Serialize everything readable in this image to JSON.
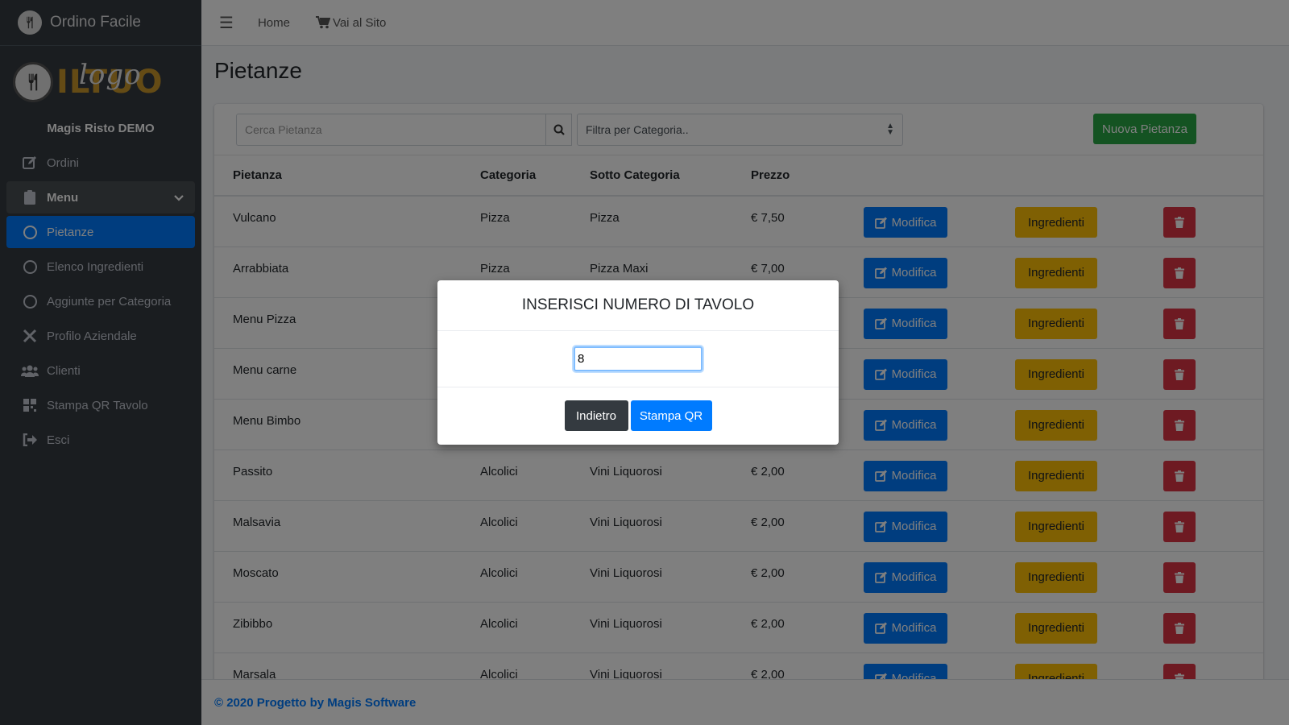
{
  "brand": {
    "title": "Ordino Facile",
    "icon": "fork-knife-icon"
  },
  "logo": {
    "text": "ILTUO",
    "script": "logo"
  },
  "company_name": "Magis Risto DEMO",
  "sidebar": {
    "items": [
      {
        "label": "Ordini",
        "icon": "edit-icon"
      },
      {
        "label": "Menu",
        "icon": "clipboard-icon"
      },
      {
        "label": "Pietanze",
        "icon": "circle-icon"
      },
      {
        "label": "Elenco Ingredienti",
        "icon": "circle-icon"
      },
      {
        "label": "Aggiunte per Categoria",
        "icon": "circle-icon"
      },
      {
        "label": "Profilo Aziendale",
        "icon": "tools-icon"
      },
      {
        "label": "Clienti",
        "icon": "users-icon"
      },
      {
        "label": "Stampa QR Tavolo",
        "icon": "qrcode-icon"
      },
      {
        "label": "Esci",
        "icon": "sign-out-icon"
      }
    ]
  },
  "topbar": {
    "home": "Home",
    "site": "Vai al Sito"
  },
  "page": {
    "title": "Pietanze"
  },
  "toolbar": {
    "search_placeholder": "Cerca Pietanza",
    "filter_label": "Filtra per Categoria..",
    "new_button": "Nuova Pietanza"
  },
  "table": {
    "headers": [
      "Pietanza",
      "Categoria",
      "Sotto Categoria",
      "Prezzo"
    ],
    "edit_label": "Modifica",
    "ingredients_label": "Ingredienti",
    "rows": [
      {
        "name": "Vulcano",
        "category": "Pizza",
        "subcategory": "Pizza",
        "price": "€ 7,50"
      },
      {
        "name": "Arrabbiata",
        "category": "Pizza",
        "subcategory": "Pizza Maxi",
        "price": "€ 7,00"
      },
      {
        "name": "Menu Pizza",
        "category": "",
        "subcategory": "",
        "price": ""
      },
      {
        "name": "Menu carne",
        "category": "",
        "subcategory": "",
        "price": ""
      },
      {
        "name": "Menu Bimbo",
        "category": "",
        "subcategory": "",
        "price": ""
      },
      {
        "name": "Passito",
        "category": "Alcolici",
        "subcategory": "Vini Liquorosi",
        "price": "€ 2,00"
      },
      {
        "name": "Malsavia",
        "category": "Alcolici",
        "subcategory": "Vini Liquorosi",
        "price": "€ 2,00"
      },
      {
        "name": "Moscato",
        "category": "Alcolici",
        "subcategory": "Vini Liquorosi",
        "price": "€ 2,00"
      },
      {
        "name": "Zibibbo",
        "category": "Alcolici",
        "subcategory": "Vini Liquorosi",
        "price": "€ 2,00"
      },
      {
        "name": "Marsala",
        "category": "Alcolici",
        "subcategory": "Vini Liquorosi",
        "price": "€ 2,00"
      }
    ]
  },
  "footer": {
    "text": "© 2020 Progetto by Magis Software"
  },
  "modal": {
    "title": "INSERISCI NUMERO DI TAVOLO",
    "input_value": "8",
    "back_label": "Indietro",
    "print_label": "Stampa QR"
  },
  "colors": {
    "sidebar_bg": "#343a40",
    "primary": "#007bff",
    "success": "#28a745",
    "warning": "#ffc107",
    "danger": "#dc3545"
  }
}
